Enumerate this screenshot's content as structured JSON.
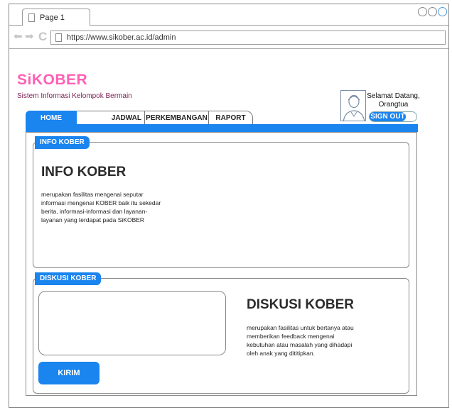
{
  "browser": {
    "tab_title": "Page 1",
    "url": "https://www.sikober.ac.id/admin"
  },
  "header": {
    "logo": "SiKOBER",
    "subtitle": "Sistem Informasi Kelompok Bermain",
    "welcome": "Selamat Datang, Orangtua",
    "signout_label": "SIGN OUT"
  },
  "nav": {
    "home": "HOME",
    "jadwal": "JADWAL",
    "perkembangan": "PERKEMBANGAN",
    "raport": "RAPORT"
  },
  "info": {
    "tag": "INFO KOBER",
    "title": "INFO KOBER",
    "description": "merupakan fasilitas mengenai seputar informasi mengenai KOBER baik itu sekedar berita, informasi-informasi dan layanan-layanan yang terdapat pada SiKOBER"
  },
  "diskusi": {
    "tag": "DISKUSI KOBER",
    "title": "DISKUSI KOBER",
    "description": "merupakan fasilitas untuk bertanya atau memberikan feedback mengenai kebutuhan atau masalah yang dihadapi oleh anak yang dititipkan.",
    "submit_label": "KIRIM",
    "input_value": ""
  },
  "colors": {
    "accent": "#1a84ef",
    "logo": "#ff5fb4",
    "subtitle": "#7a1c53"
  }
}
